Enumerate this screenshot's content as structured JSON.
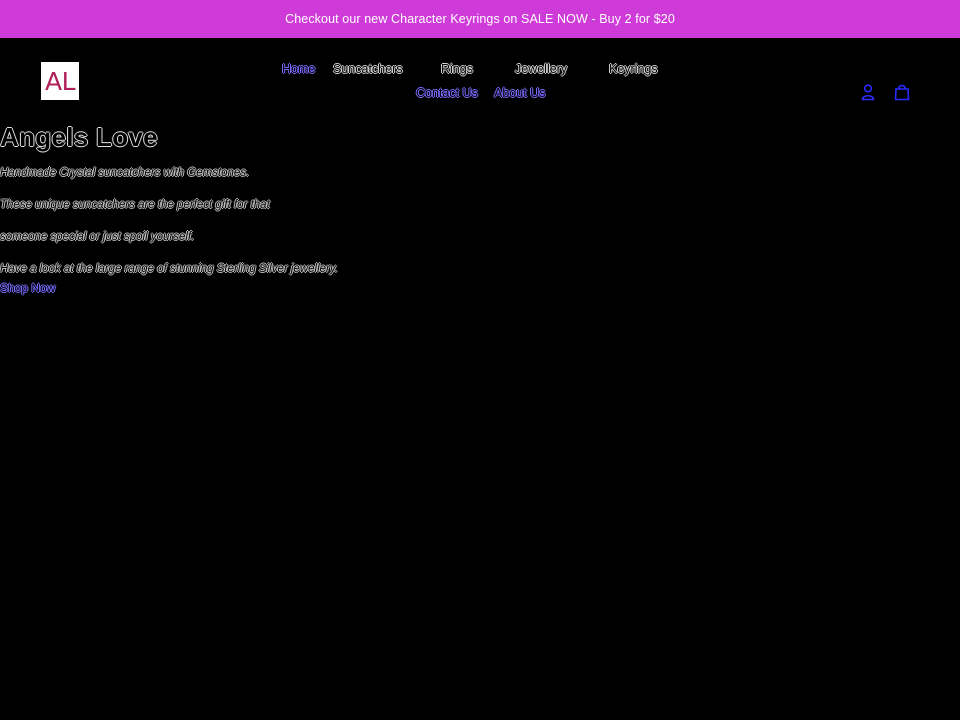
{
  "announcement": {
    "text": "Checkout our new Character Keyrings on SALE NOW - Buy 2 for $20"
  },
  "header": {
    "logo_text": "AL",
    "nav": {
      "home": "Home",
      "suncatchers": "Suncatchers",
      "rings": "Rings",
      "jewellery": "Jewellery",
      "keyrings": "Keyrings",
      "contact": "Contact Us",
      "about": "About Us"
    },
    "icons": {
      "account": "account-icon",
      "cart": "cart-icon"
    }
  },
  "hero": {
    "title": "Angels Love",
    "paragraphs": [
      "Handmade Crystal suncatchers with Gemstones.",
      "These unique suncatchers are the perfect gift for that",
      "someone special or just spoil yourself.",
      "Have a look at the large range of stunning Sterling Silver jewellery."
    ],
    "cta": "Shop Now"
  },
  "colors": {
    "announcement_bg": "#cf3bd8",
    "page_bg": "#000000",
    "link_accent": "#7b6cff",
    "icon_blue": "#2a2cff",
    "logo_text": "#b0205a"
  }
}
